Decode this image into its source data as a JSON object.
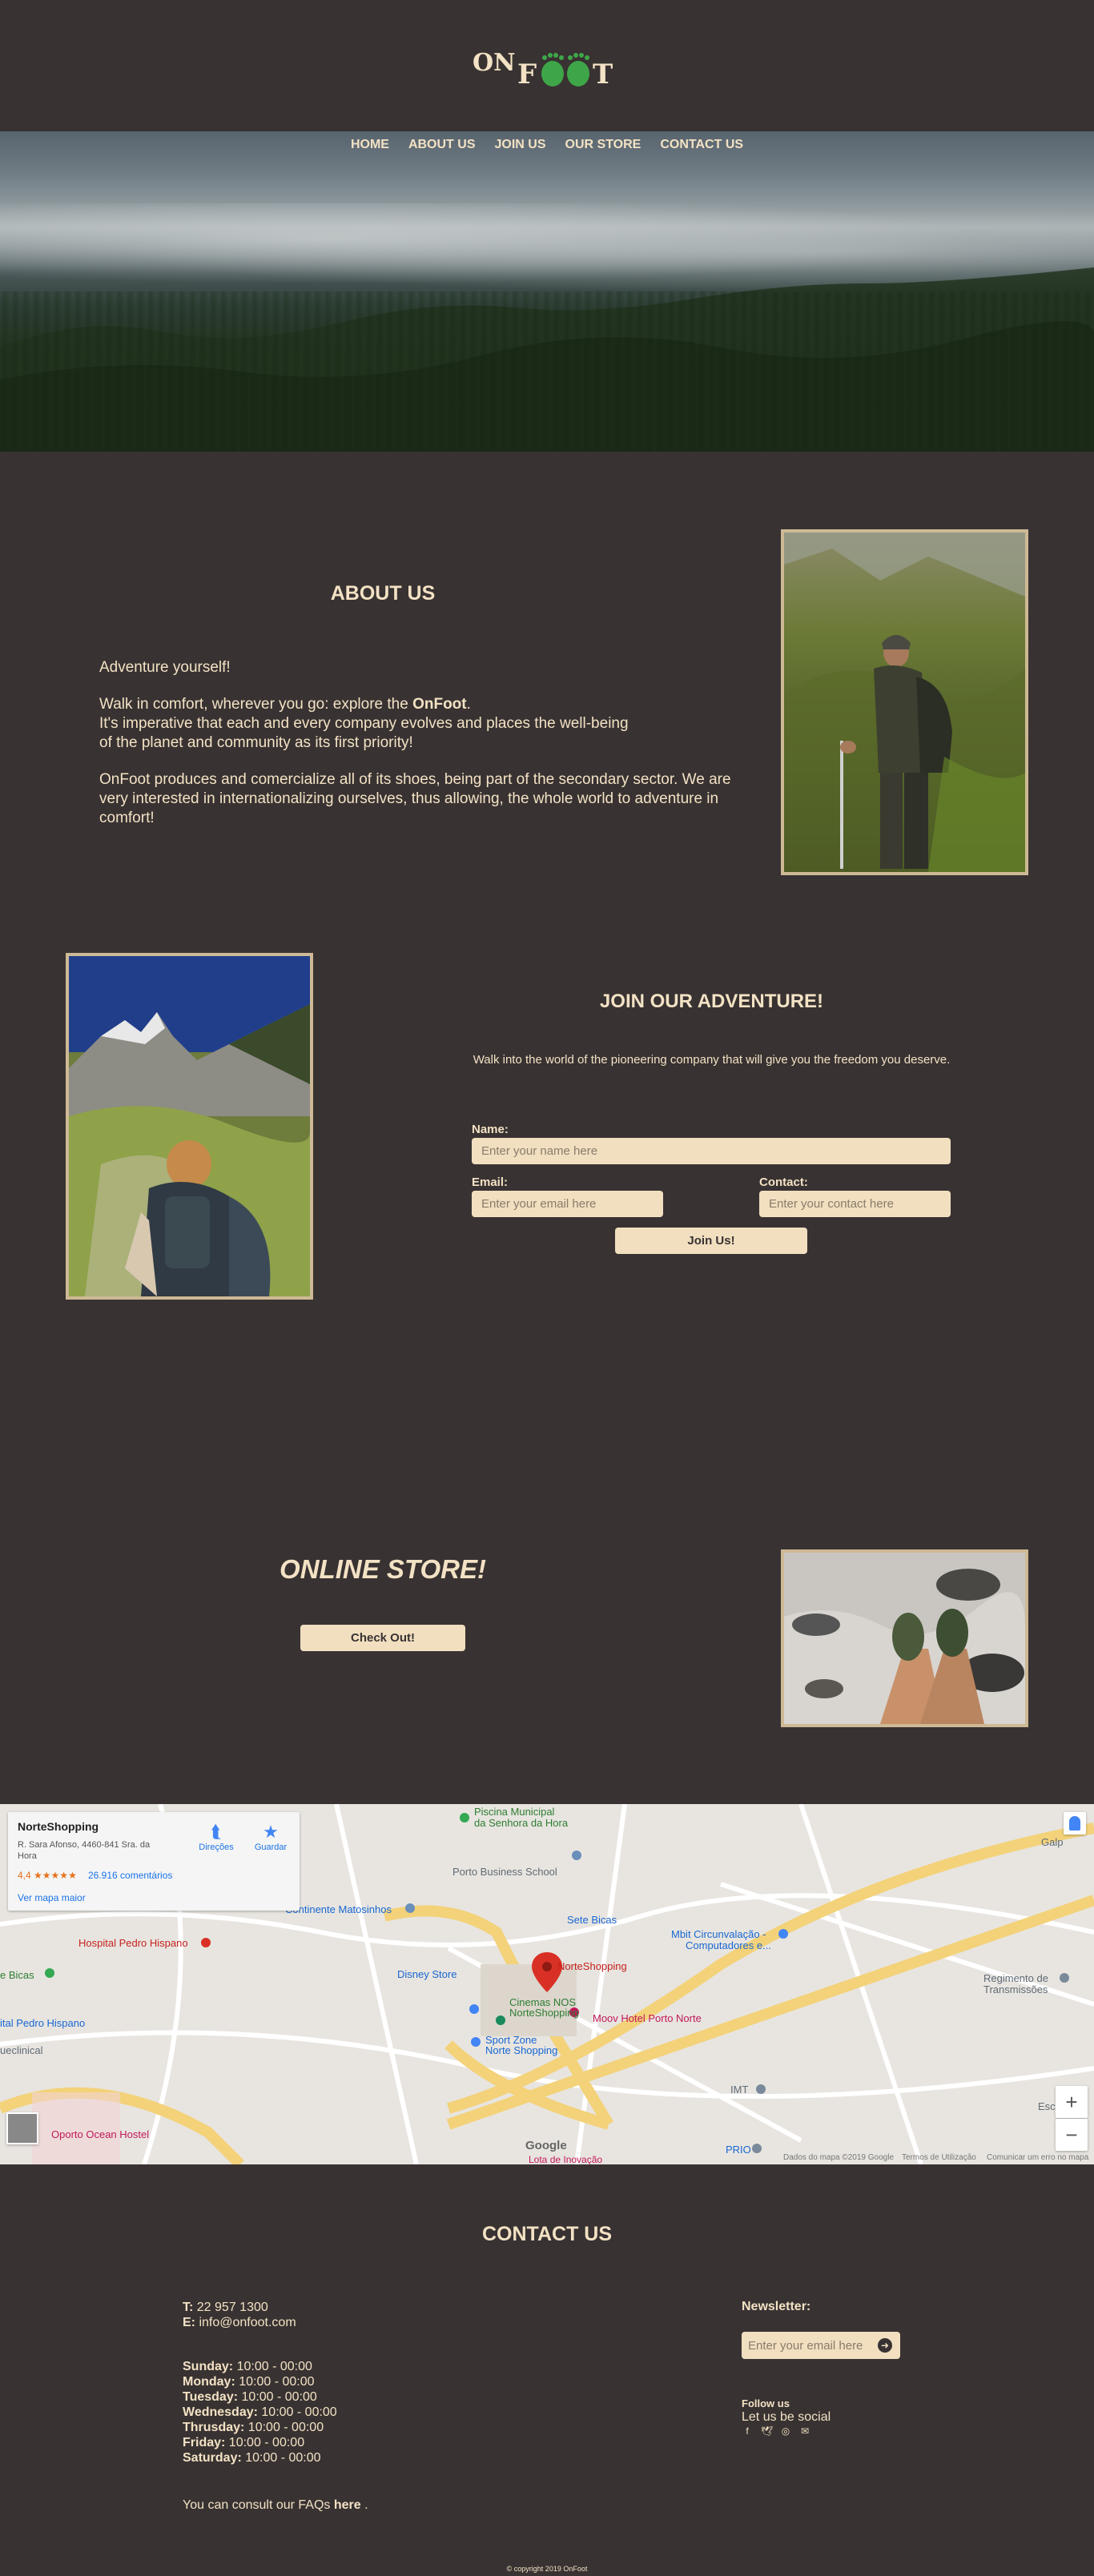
{
  "brand": {
    "logo_text_left": "ON",
    "logo_text_right": "T",
    "logo_accent_color": "#3ea648"
  },
  "nav": {
    "items": [
      "HOME",
      "ABOUT US",
      "JOIN US",
      "OUR STORE",
      "CONTACT US"
    ]
  },
  "about": {
    "title": "ABOUT US",
    "tagline": "Adventure yourself!",
    "p1_prefix": "Walk in comfort, wherever you go: explore the ",
    "p1_brand": "OnFoot",
    "p1_suffix": ".",
    "p1_line2": "It's imperative that each and every company evolves and places the well-being",
    "p1_line3": "of the planet and community as its first priority!",
    "p2": "OnFoot produces and comercialize all of its shoes, being part of the secondary sector. We are very interested in internationalizing ourselves, thus allowing, the whole world to adventure in comfort!"
  },
  "join": {
    "title": "JOIN OUR ADVENTURE!",
    "description": "Walk into the world of the pioneering company that will give you the freedom you deserve.",
    "name_label": "Name:",
    "name_placeholder": "Enter your name here",
    "email_label": "Email:",
    "email_placeholder": "Enter your email here",
    "contact_label": "Contact:",
    "contact_placeholder": "Enter your contact here",
    "submit_label": "Join Us!"
  },
  "store": {
    "title": "ONLINE STORE!",
    "button_label": "Check Out!"
  },
  "map": {
    "place_name": "NorteShopping",
    "address": "R. Sara Afonso, 4460-841 Sra. da Hora",
    "rating": "4,4",
    "stars": "★★★★★",
    "reviews": "26.916 comentários",
    "bigger_map": "Ver mapa maior",
    "directions": "Direções",
    "save": "Guardar",
    "labels": {
      "piscina": "Piscina Municipal",
      "piscina2": "da Senhora da Hora",
      "porto_business": "Porto Business School",
      "continente": "Continente Matosinhos",
      "sete_bicas": "Sete Bicas",
      "mbit": "Mbit Circunvalação -",
      "mbit2": "Computadores e...",
      "hospital": "Hospital Pedro Hispano",
      "norteshopping": "NorteShopping",
      "disney": "Disney Store",
      "cinemas": "Cinemas NOS",
      "cinemas2": "NorteShopping",
      "moov": "Moov Hotel Porto Norte",
      "sport_zone": "Sport Zone",
      "sport_zone2": "Norte Shopping",
      "regimento": "Regimento de",
      "regimento2": "Transmissões",
      "bicas": "e Bicas",
      "pedro_hispano": "ital Pedro Hispano",
      "queclinical": "ueclinical",
      "imt": "IMT",
      "prio": "PRIO",
      "escola": "Escola",
      "oporto": "Oporto Ocean Hostel",
      "galp": "Galp",
      "google": "Google",
      "map_data": "Dados do mapa ©2019 Google",
      "terms": "Termos de Utilização",
      "report": "Comunicar um erro no mapa",
      "lota": "Lota de Inovação"
    }
  },
  "contact": {
    "title": "CONTACT US",
    "phone_label": "T:",
    "phone": "22 957 1300",
    "email_label": "E:",
    "email": "info@onfoot.com",
    "hours": [
      {
        "day": "Sunday:",
        "time": "10:00 - 00:00"
      },
      {
        "day": "Monday:",
        "time": "10:00 - 00:00"
      },
      {
        "day": "Tuesday:",
        "time": "10:00 - 00:00"
      },
      {
        "day": "Wednesday:",
        "time": "10:00 - 00:00"
      },
      {
        "day": "Thrusday:",
        "time": "10:00 - 00:00"
      },
      {
        "day": "Friday:",
        "time": "10:00 - 00:00"
      },
      {
        "day": "Saturday:",
        "time": "10:00 - 00:00"
      }
    ],
    "faq_prefix": "You can consult our FAQs ",
    "faq_link": "here",
    "faq_suffix": " .",
    "newsletter_label": "Newsletter:",
    "newsletter_placeholder": "Enter your email here",
    "follow": "Follow us",
    "social_text": "Let us be social",
    "social_icons": [
      "facebook-icon",
      "twitter-icon",
      "instagram-icon",
      "envelope-icon"
    ]
  },
  "footer": {
    "copyright": "© copyright 2019 OnFoot"
  }
}
